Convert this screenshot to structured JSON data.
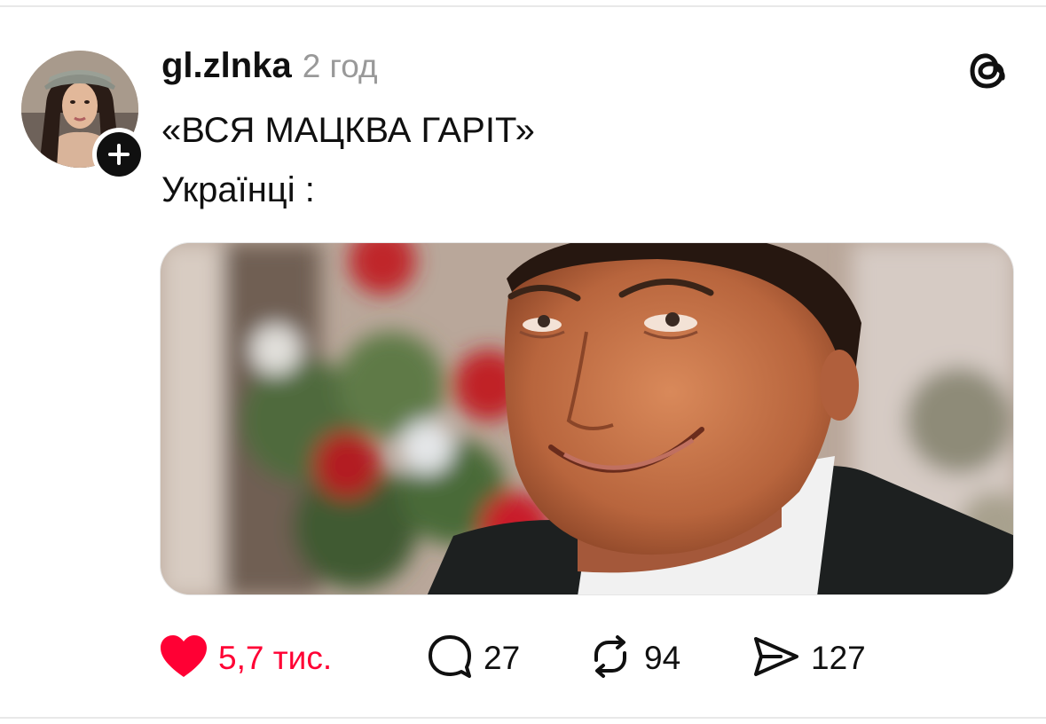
{
  "post": {
    "username": "gl.zlnka",
    "time": "2 год",
    "text_line1": "«ВСЯ МАЦКВА ГАРІТ»",
    "text_line2": "Українці :",
    "media_description": ""
  },
  "actions": {
    "likes": "5,7 тис.",
    "replies": "27",
    "reposts": "94",
    "shares": "127",
    "liked": true
  },
  "icons": {
    "app_logo": "threads-logo-icon",
    "like": "heart-filled-icon",
    "reply": "speech-bubble-icon",
    "repost": "repost-arrows-icon",
    "share": "paper-plane-icon",
    "follow": "plus-icon"
  },
  "colors": {
    "like_red": "#ff0034",
    "text": "#101010",
    "muted": "#999999",
    "divider": "#e8e8e8"
  }
}
